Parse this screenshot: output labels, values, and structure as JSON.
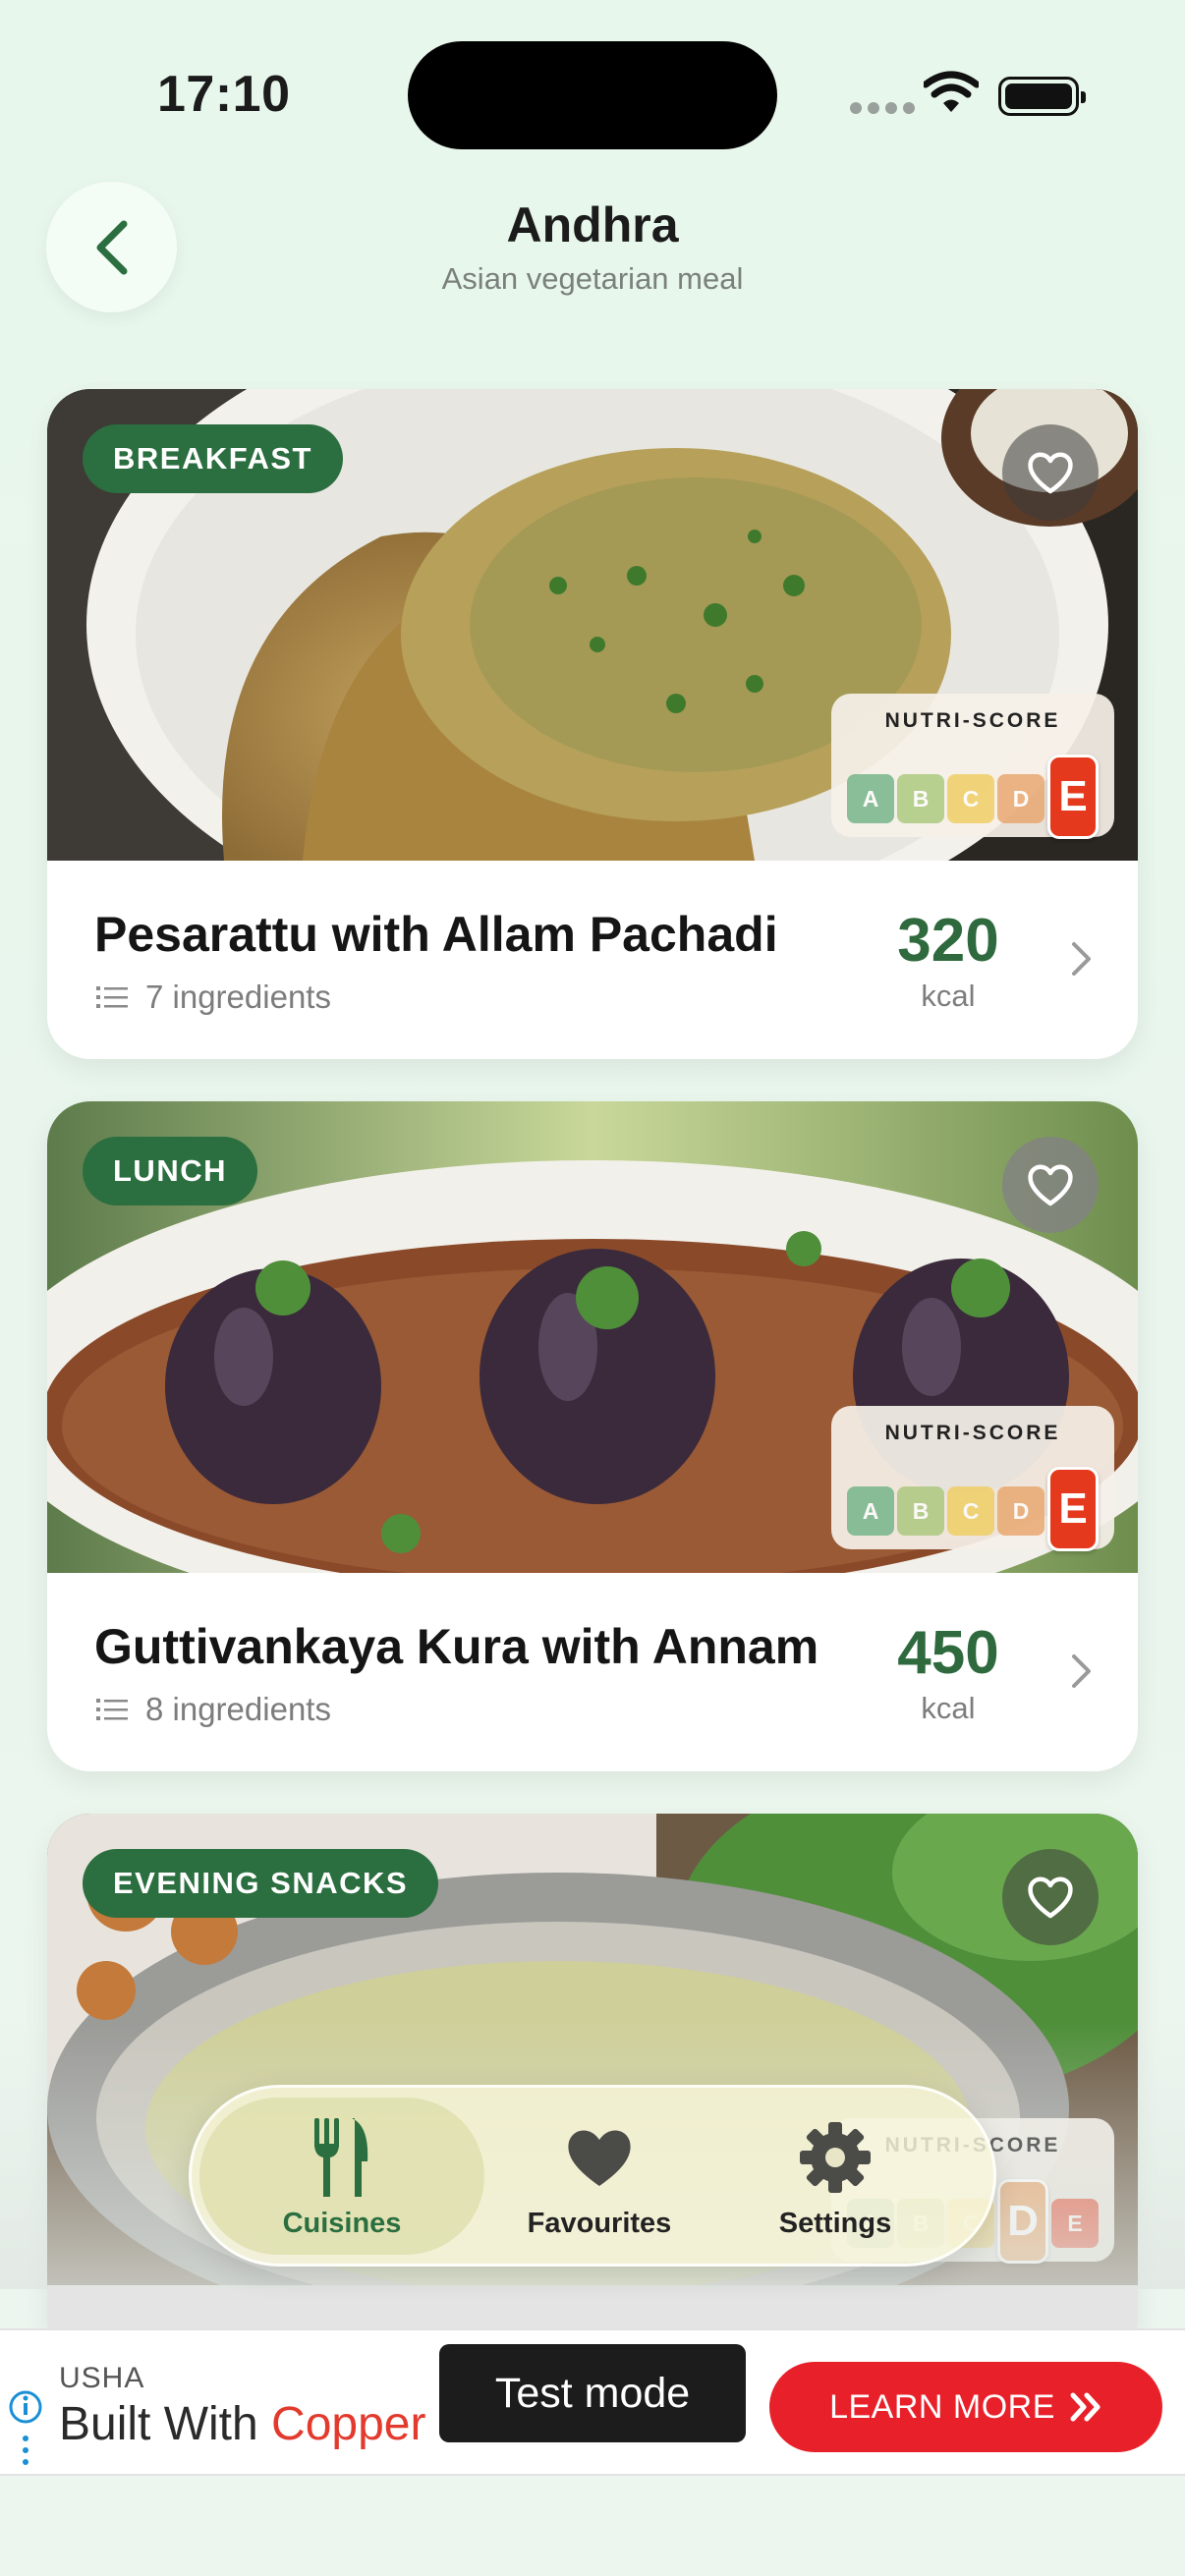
{
  "status_bar": {
    "time": "17:10"
  },
  "header": {
    "title": "Andhra",
    "subtitle": "Asian vegetarian meal"
  },
  "nutri_score_label": "NUTRI-SCORE",
  "nutri_grades": [
    "A",
    "B",
    "C",
    "D",
    "E"
  ],
  "nutri_colors": {
    "A": "#6fb286",
    "B": "#a8c77a",
    "C": "#f0cd5e",
    "D": "#e9a56a",
    "E": "#e4391c"
  },
  "recipes": [
    {
      "meal": "BREAKFAST",
      "name": "Pesarattu with Allam Pachadi",
      "ingredients": "7 ingredients",
      "kcal": "320",
      "kcal_unit": "kcal",
      "nutri_score": "E"
    },
    {
      "meal": "LUNCH",
      "name": "Guttivankaya Kura with Annam",
      "ingredients": "8 ingredients",
      "kcal": "450",
      "kcal_unit": "kcal",
      "nutri_score": "E"
    },
    {
      "meal": "EVENING SNACKS",
      "name": "",
      "ingredients": "",
      "kcal": "",
      "kcal_unit": "",
      "nutri_score": "D"
    }
  ],
  "tabbar": {
    "items": [
      {
        "label": "Cuisines",
        "icon": "fork-knife-icon",
        "active": true
      },
      {
        "label": "Favourites",
        "icon": "heart-icon",
        "active": false
      },
      {
        "label": "Settings",
        "icon": "gear-icon",
        "active": false
      }
    ]
  },
  "ad": {
    "brand": "USHA",
    "headline_start": "Built With ",
    "headline_highlight": "Copper",
    "test_label": "Test mode",
    "cta": "LEARN MORE"
  },
  "colors": {
    "accent": "#2b6e3f",
    "tag_bg": "#2b6e3f",
    "kcal": "#2e6a3d",
    "cta": "#e8202a"
  }
}
